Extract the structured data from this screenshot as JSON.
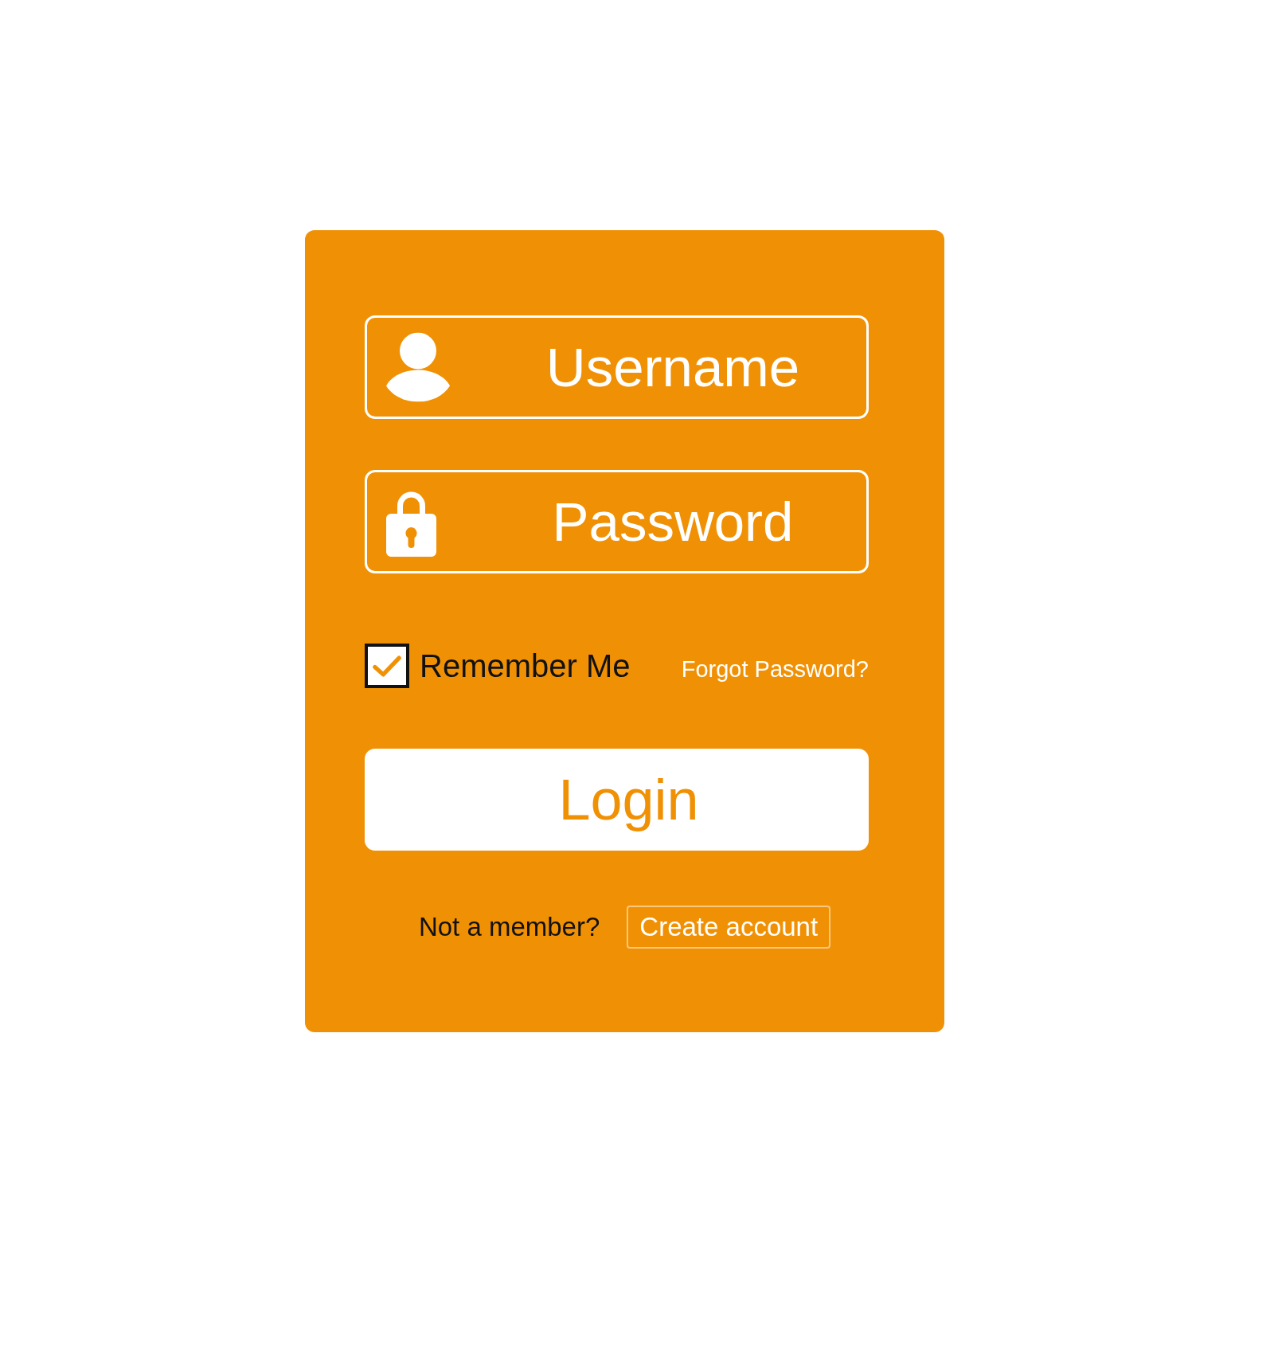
{
  "fields": [
    {
      "kind": "username",
      "placeholder": "Username"
    },
    {
      "kind": "password",
      "placeholder": "Password"
    }
  ],
  "remember_me": {
    "label": "Remember Me",
    "checked": true
  },
  "forgot_password": {
    "label": "Forgot Password?"
  },
  "login_button": {
    "label": "Login"
  },
  "signup": {
    "prompt": "Not a member?",
    "button": "Create account"
  }
}
